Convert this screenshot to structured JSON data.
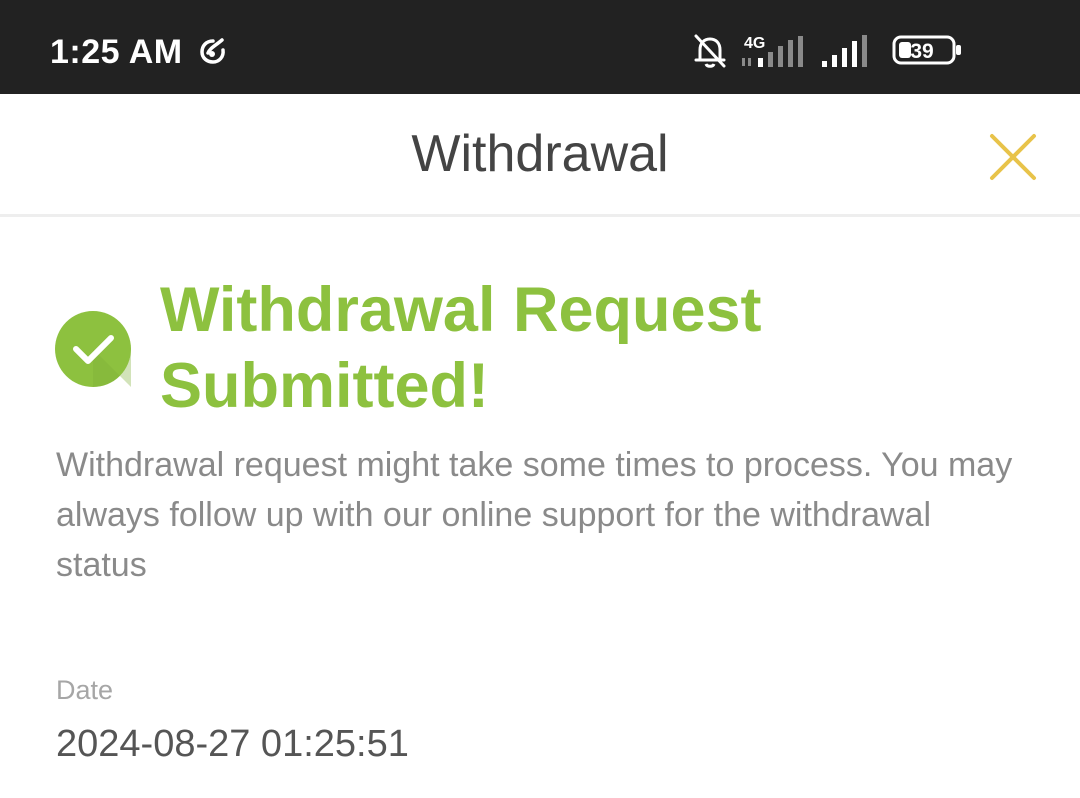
{
  "status_bar": {
    "time": "1:25 AM",
    "network_label": "4G",
    "battery_level": "39",
    "icons": [
      "app-notification-icon",
      "bell-off-icon",
      "signal-4g-icon",
      "signal-icon",
      "battery-icon"
    ]
  },
  "header": {
    "title": "Withdrawal",
    "close_icon": "close-icon"
  },
  "confirmation": {
    "icon": "check-circle-icon",
    "title": "Withdrawal Request Submitted!",
    "message": "Withdrawal request might take some times to process. You may always follow up with our online support for the withdrawal status"
  },
  "details": {
    "date_label": "Date",
    "date_value": "2024-08-27 01:25:51"
  },
  "colors": {
    "status_bar_bg": "#222222",
    "accent_green": "#8dc13f",
    "close_yellow": "#e8c34a",
    "title_text": "#444444",
    "body_text": "#8a8a8a"
  }
}
